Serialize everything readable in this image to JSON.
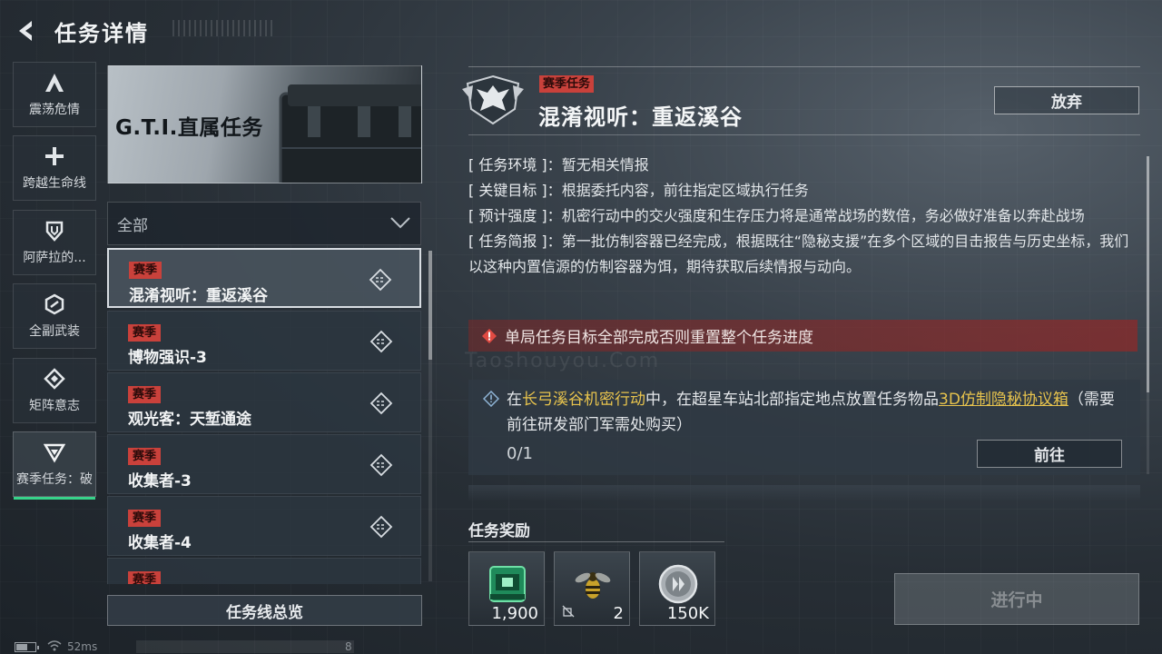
{
  "header": {
    "title": "任务详情"
  },
  "rail": {
    "items": [
      {
        "label": "震荡危情",
        "icon": "triangle-a-icon"
      },
      {
        "label": "跨越生命线",
        "icon": "plus-icon"
      },
      {
        "label": "阿萨拉的...",
        "icon": "shield-icon"
      },
      {
        "label": "全副武装",
        "icon": "hexagon-icon"
      },
      {
        "label": "矩阵意志",
        "icon": "diamond-icon"
      },
      {
        "label": "赛季任务：破",
        "icon": "chevron-down-icon",
        "active": true
      }
    ]
  },
  "banner": {
    "title": "G.T.I.直属任务"
  },
  "filter": {
    "selected": "全部"
  },
  "missions": [
    {
      "tag": "赛季",
      "name": "混淆视听：重返溪谷",
      "selected": true
    },
    {
      "tag": "赛季",
      "name": "博物强识-3"
    },
    {
      "tag": "赛季",
      "name": "观光客：天堑通途"
    },
    {
      "tag": "赛季",
      "name": "收集者-3"
    },
    {
      "tag": "赛季",
      "name": "收集者-4"
    },
    {
      "tag": "赛季",
      "name": ""
    }
  ],
  "overview_button": "任务线总览",
  "status": {
    "ping": "52ms",
    "num": "8"
  },
  "detail": {
    "tag": "赛季任务",
    "title": "混淆视听：重返溪谷",
    "abandon": "放弃",
    "info": [
      {
        "key": "[ 任务环境 ]",
        "value": "暂无相关情报"
      },
      {
        "key": "[ 关键目标 ]",
        "value": "根据委托内容，前往指定区域执行任务"
      },
      {
        "key": "[ 预计强度 ]",
        "value": "机密行动中的交火强度和生存压力将是通常战场的数倍，务必做好准备以奔赴战场"
      },
      {
        "key": "[ 任务简报 ]",
        "value": "第一批仿制容器已经完成，根据既往“隐秘支援”在多个区域的目击报告与历史坐标，我们以这种内置信源的仿制容器为饵，期待获取后续情报与动向。"
      }
    ],
    "warning": "单局任务目标全部完成否则重置整个任务进度",
    "watermark": "Taoshouyou.Com",
    "objective": {
      "pre": "在",
      "location": "长弓溪谷机密行动",
      "mid": "中，在超星车站北部指定地点放置任务物品",
      "item": "3D仿制隐秘协议箱",
      "post": "（需要前往研发部门军需处购买）",
      "progress": "0/1",
      "goto": "前往"
    },
    "rewards_title": "任务奖励",
    "rewards": [
      {
        "icon": "emerald-box-icon",
        "qty": "1,900"
      },
      {
        "icon": "wasp-icon",
        "qty": "2"
      },
      {
        "icon": "silver-coin-icon",
        "qty": "150K"
      }
    ],
    "progress_button": "进行中"
  },
  "colors": {
    "season_red": "#c9413b",
    "highlight_gold": "#e7c34d",
    "active_green": "#37d38a"
  }
}
